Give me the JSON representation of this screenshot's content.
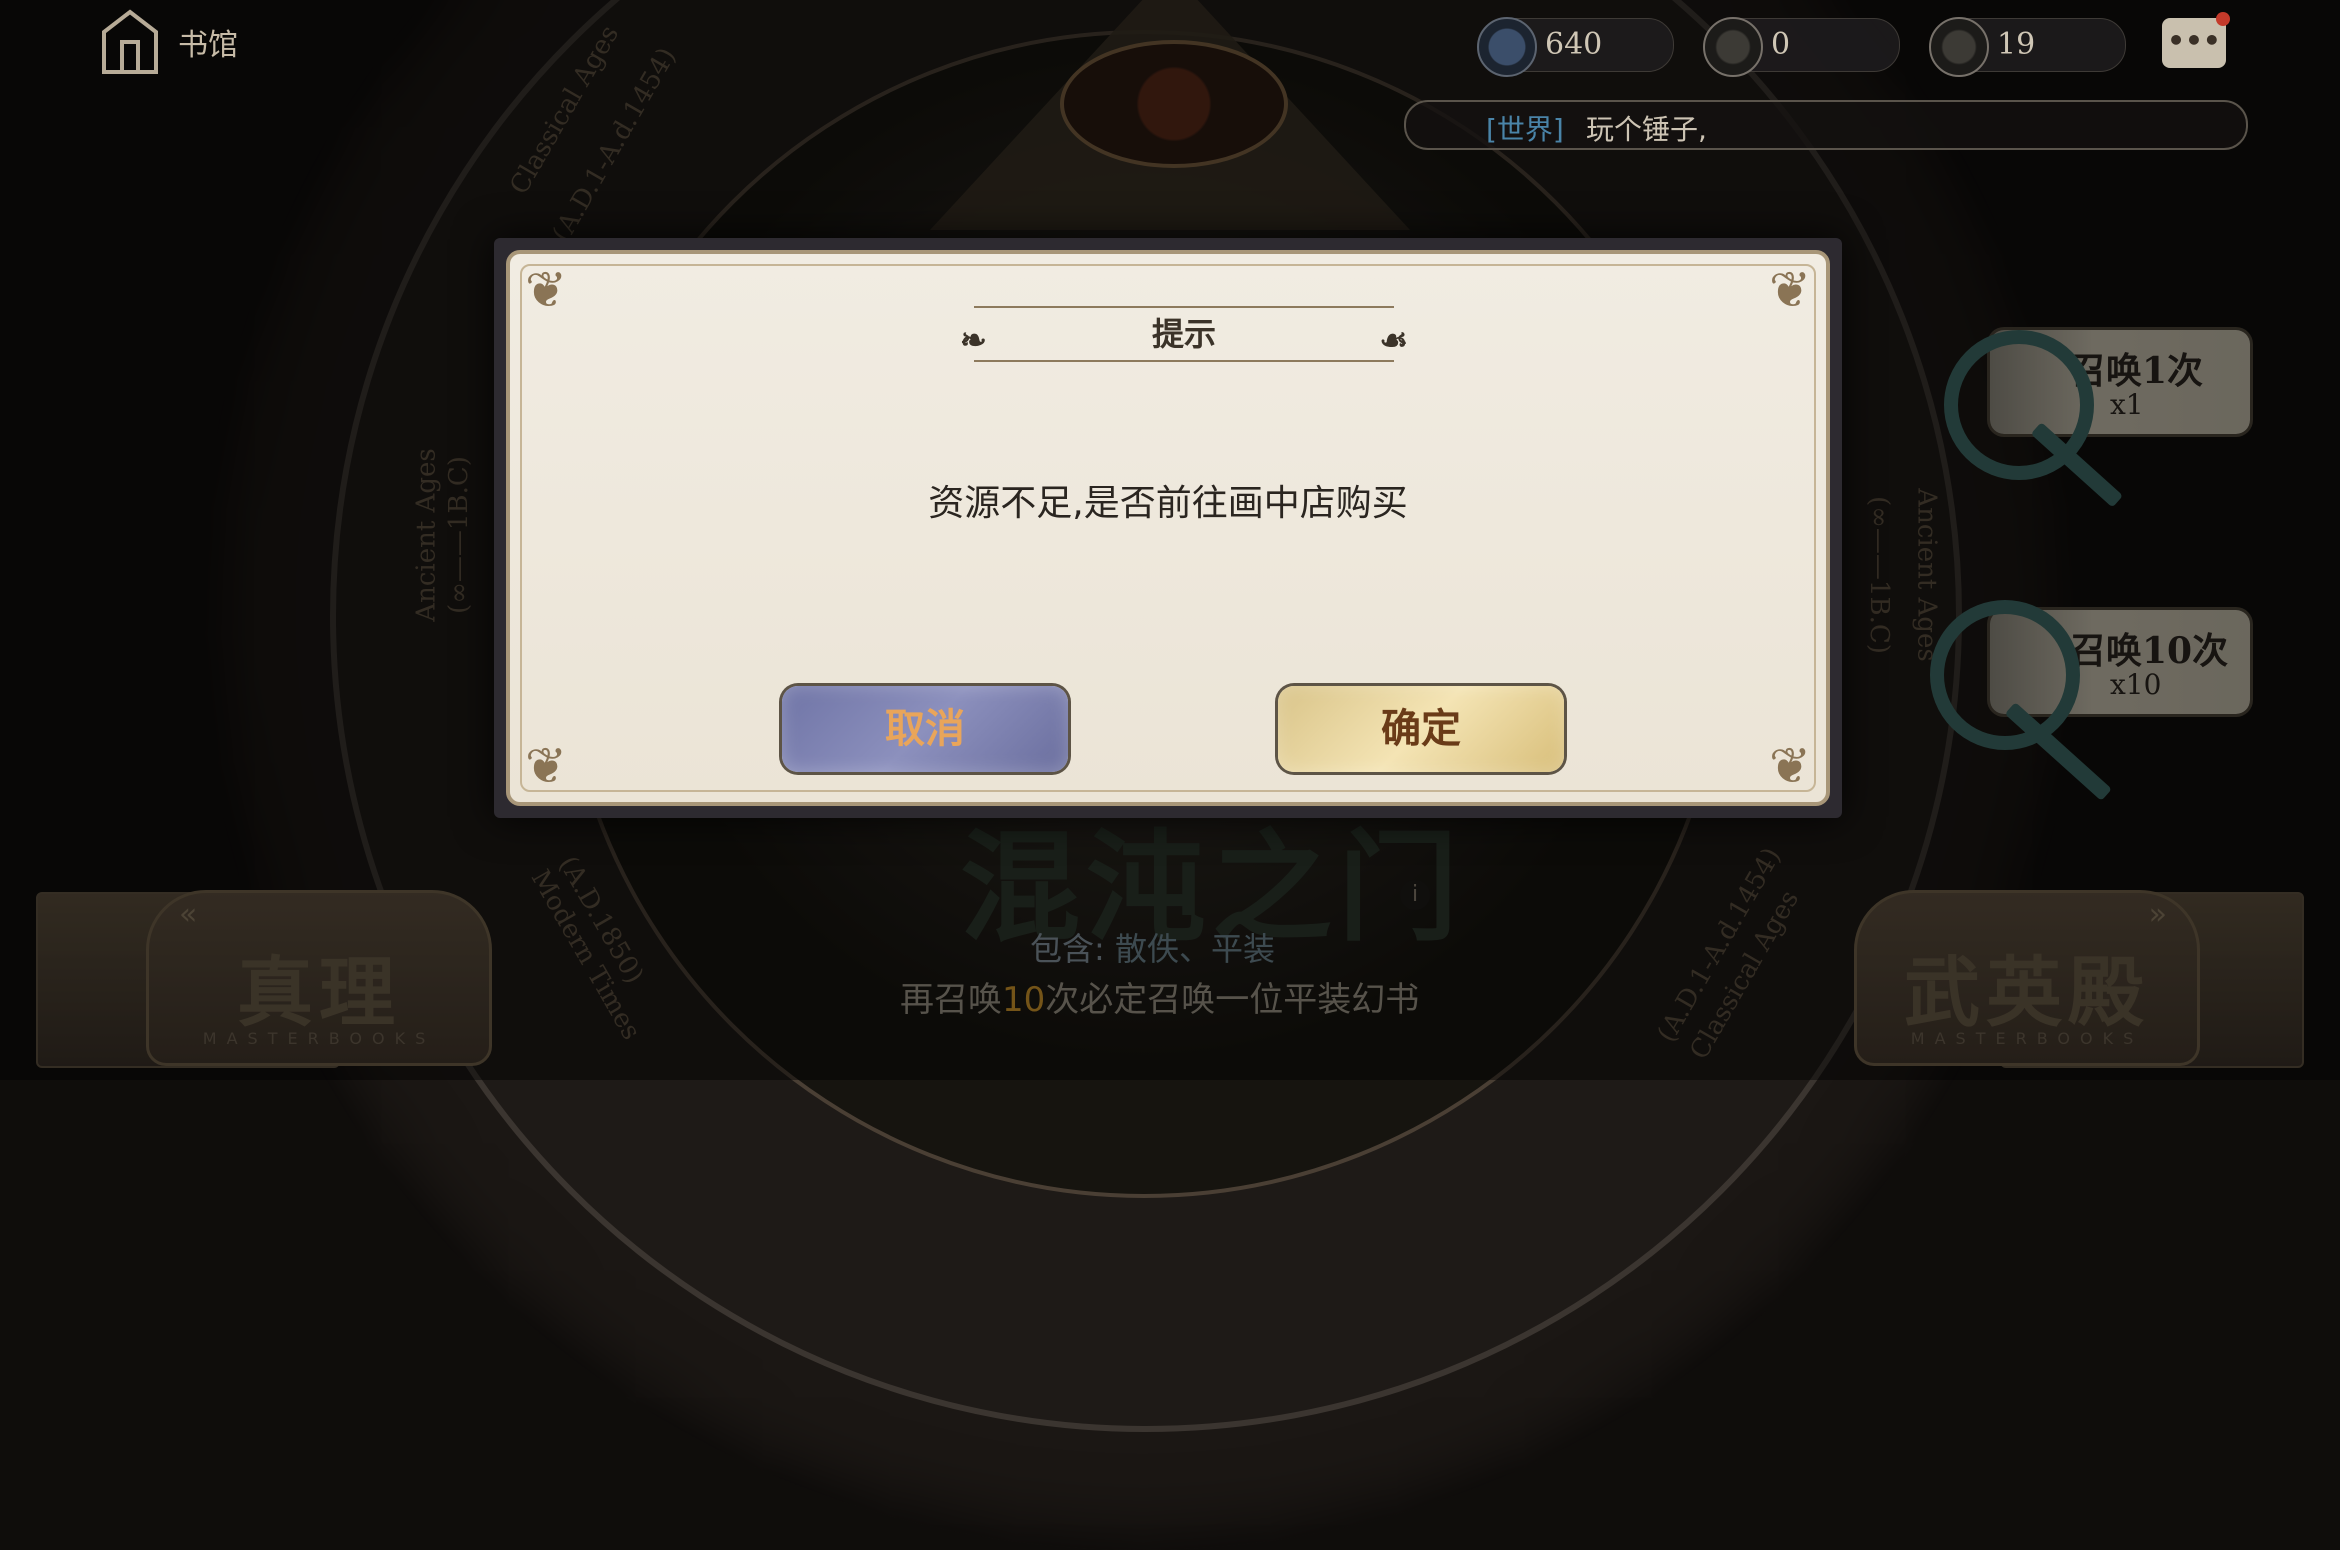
{
  "topbar": {
    "home_label": "书馆",
    "resources": [
      {
        "icon": "feather-crystal-icon",
        "value": "640"
      },
      {
        "icon": "key-icon",
        "value": "0"
      },
      {
        "icon": "key-icon",
        "value": "19"
      }
    ],
    "chat_icon": "chat-bubble-icon"
  },
  "world_chat": {
    "channel": "[世界]",
    "message": "玩个锤子,"
  },
  "wheel_labels": {
    "classical_top": "Classical Ages",
    "classical_top_range": "(A.D.1-A.d.1454)",
    "ancient_left": "Ancient Ages",
    "ancient_left_range": "(∞——1B.C)",
    "ancient_right": "Ancient Ages",
    "ancient_right_range": "(∞——1B.C)",
    "modern_bottom": "Modern Times",
    "modern_bottom_range": "(A.D.1850)",
    "classical_bottom": "Classical Ages",
    "classical_bottom_range": "(A.D.1-A.d.1454)"
  },
  "summon": [
    {
      "title": "召唤1次",
      "count": "x1"
    },
    {
      "title": "召唤10次",
      "count": "x10"
    }
  ],
  "gate": {
    "title": "混沌之门",
    "contains_label": "包含:",
    "contains_value": "散佚、平装",
    "pity_prefix": "再召唤",
    "pity_number": "10",
    "pity_suffix": "次必定召唤一位平装幻书"
  },
  "nav": {
    "left_label": "真理",
    "left_sub": "MASTERBOOKS",
    "right_label": "武英殿",
    "right_sub": "MASTERBOOKS"
  },
  "dialog": {
    "title": "提示",
    "message": "资源不足,是否前往画中店购买",
    "cancel_label": "取消",
    "confirm_label": "确定"
  },
  "colors": {
    "cancel_button": "#7b80b0",
    "confirm_button": "#e9d59c",
    "world_channel": "#4a84a8",
    "pity_number": "#d39a2c"
  }
}
